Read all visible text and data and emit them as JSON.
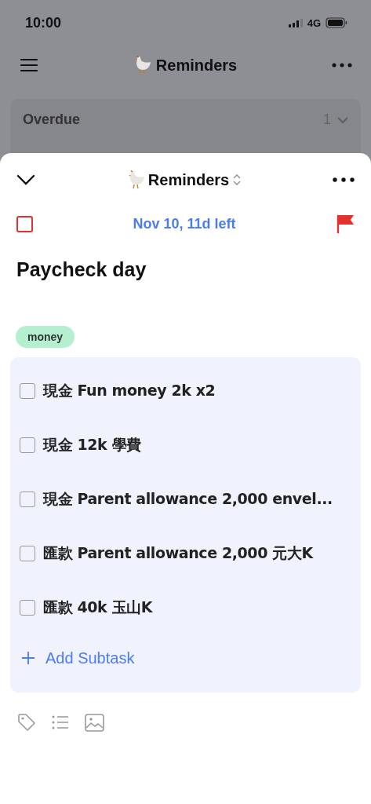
{
  "status_bar": {
    "time": "10:00",
    "network": "4G"
  },
  "background": {
    "title": "Reminders",
    "section": {
      "label": "Overdue",
      "count": "1"
    }
  },
  "sheet": {
    "list_name": "Reminders",
    "date": "Nov 10, 11d left",
    "checked": false,
    "flagged": true,
    "title": "Paycheck day",
    "tags": [
      {
        "label": "money",
        "color": "#b4f0cf"
      }
    ],
    "subtasks": [
      {
        "text": "現金 Fun money 2k x2",
        "checked": false
      },
      {
        "text": "現金 12k 學費",
        "checked": false
      },
      {
        "text": "現金 Parent allowance 2,000 envel...",
        "checked": false
      },
      {
        "text": "匯款 Parent allowance 2,000 元大K",
        "checked": false
      },
      {
        "text": "匯款 40k 玉山K",
        "checked": false
      }
    ],
    "add_subtask": "Add Subtask"
  }
}
